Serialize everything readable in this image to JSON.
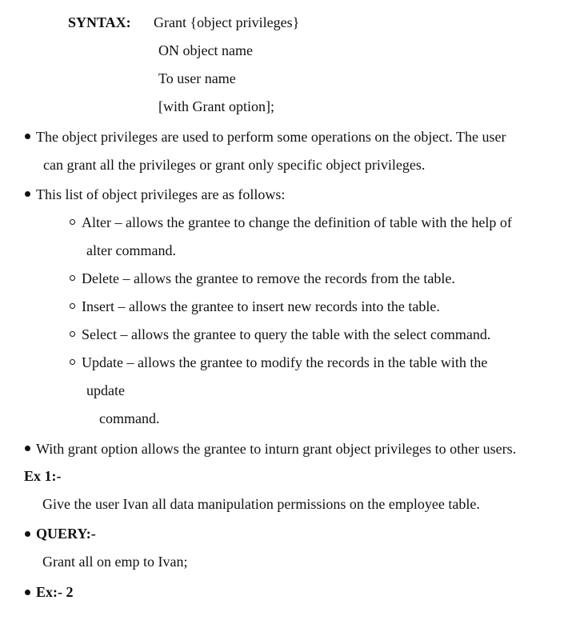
{
  "syntax": {
    "label": "SYNTAX:",
    "lines": [
      "Grant {object privileges}",
      "ON object name",
      "To user name",
      "[with Grant option];"
    ]
  },
  "bullets": {
    "object_privileges": [
      "The object privileges are used to perform some operations on the object. The user",
      "can grant all the privileges or grant only specific object privileges."
    ],
    "list_intro": "This list of object privileges are as follows:",
    "with_grant": "With grant option allows the grantee to inturn grant object privileges to other users."
  },
  "privileges": {
    "alter": [
      "Alter – allows the grantee to change the definition of table with the help of",
      "alter command."
    ],
    "delete": "Delete – allows the grantee to remove the records from the table.",
    "insert": "Insert – allows the grantee to insert new records into the table.",
    "select": "Select – allows the grantee to query the table with the select command.",
    "update": [
      "Update – allows the grantee to modify the records in the table with the",
      "update",
      "command."
    ]
  },
  "example1": {
    "label": "Ex 1:-",
    "text": "Give the user Ivan all data manipulation permissions on the employee table."
  },
  "query": {
    "label": "QUERY:-",
    "text": "Grant all on emp to Ivan;"
  },
  "example2": {
    "label": "Ex:- 2"
  }
}
